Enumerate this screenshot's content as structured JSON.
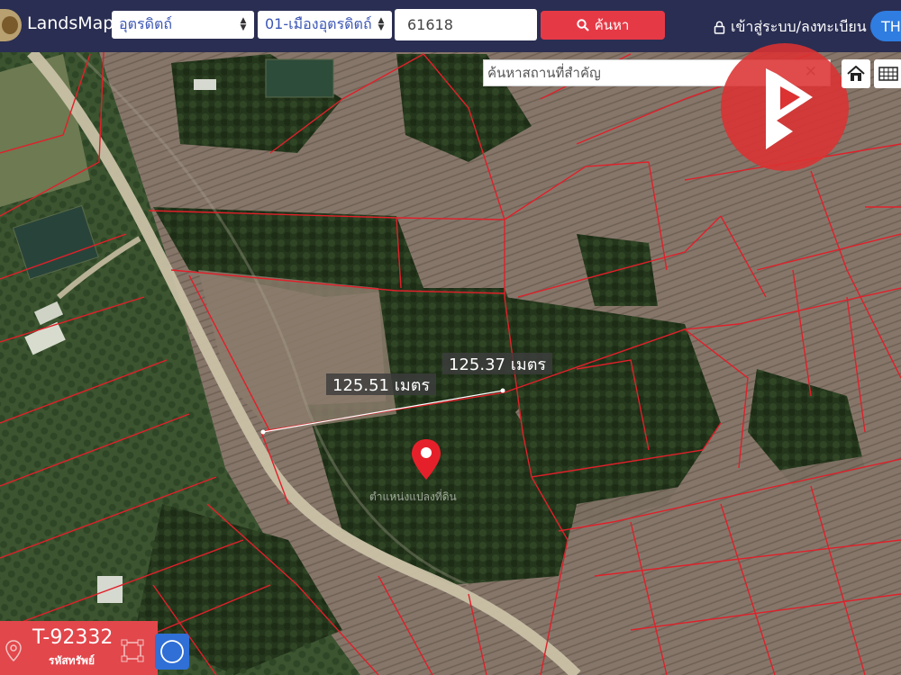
{
  "header": {
    "brand": "LandsMaps",
    "province_select": "อุตรดิตถ์",
    "district_select": "01-เมืองอุตรดิตถ์",
    "parcel_input": "61618",
    "search_button": "ค้นหา",
    "login_link": "เข้าสู่ระบบ/ลงทะเบียน",
    "language": "TH"
  },
  "map": {
    "place_search_placeholder": "ค้นหาสถานที่สำคัญ",
    "measurements": [
      "125.37 เมตร",
      "125.51 เมตร"
    ],
    "pin_label": "ตำแหน่งแปลงที่ดิน",
    "colors": {
      "parcel_line": "#e0202a",
      "pin": "#e6202a"
    }
  },
  "property": {
    "code": "T-92332",
    "code_label": "รหัสทรัพย์"
  },
  "icons": [
    "search-icon",
    "lock-icon",
    "home-icon",
    "grid-icon",
    "location-icon",
    "draw-polygon-icon",
    "measure-circle-icon",
    "close-icon"
  ]
}
